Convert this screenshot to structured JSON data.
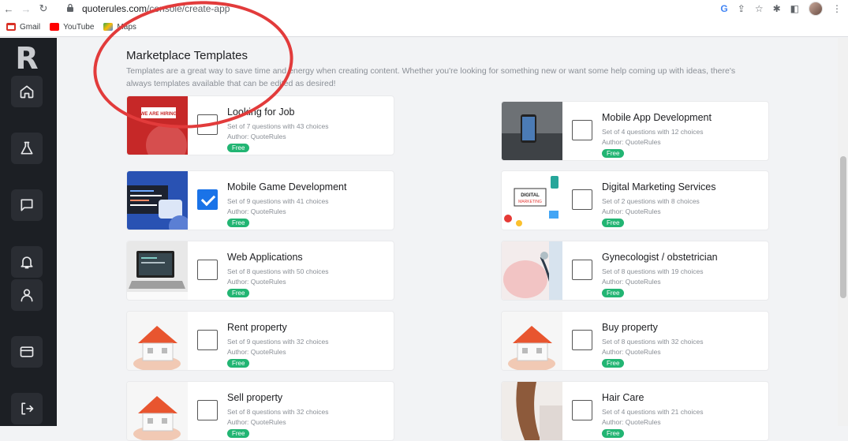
{
  "browser": {
    "url_host": "quoterules.com",
    "url_path": "/console/create-app",
    "bookmarks": [
      {
        "label": "Gmail",
        "color": "#d93025"
      },
      {
        "label": "YouTube",
        "color": "#ff0000"
      },
      {
        "label": "Maps",
        "color": "#34a853"
      }
    ]
  },
  "sidebar": {
    "logo": "R",
    "items": [
      "home-icon",
      "flask-icon",
      "chat-icon",
      "bell-icon",
      "user-icon",
      "card-icon",
      "logout-icon"
    ]
  },
  "main": {
    "title": "Marketplace Templates",
    "description": "Templates are a great way to save time and energy when creating content. Whether you're looking for something new or want some help coming up with ideas, there's always templates available that can be edited as desired!"
  },
  "templates": [
    {
      "title": "Looking for Job",
      "meta": "Set of 7 questions with 43 choices",
      "author": "Author: QuoteRules",
      "badge": "Free",
      "checked": false,
      "thumb": "hiring"
    },
    {
      "title": "Mobile App Development",
      "meta": "Set of 4 questions with 12 choices",
      "author": "Author: QuoteRules",
      "badge": "Free",
      "checked": false,
      "thumb": "phone"
    },
    {
      "title": "Mobile Game Development",
      "meta": "Set of 9 questions with 41 choices",
      "author": "Author: QuoteRules",
      "badge": "Free",
      "checked": true,
      "thumb": "code"
    },
    {
      "title": "Digital Marketing Services",
      "meta": "Set of 2 questions with 8 choices",
      "author": "Author: QuoteRules",
      "badge": "Free",
      "checked": false,
      "thumb": "marketing"
    },
    {
      "title": "Web Applications",
      "meta": "Set of 8 questions with 50 choices",
      "author": "Author: QuoteRules",
      "badge": "Free",
      "checked": false,
      "thumb": "laptop"
    },
    {
      "title": "Gynecologist / obstetrician",
      "meta": "Set of 8 questions with 19 choices",
      "author": "Author: QuoteRules",
      "badge": "Free",
      "checked": false,
      "thumb": "pregnant"
    },
    {
      "title": "Rent property",
      "meta": "Set of 9 questions with 32 choices",
      "author": "Author: QuoteRules",
      "badge": "Free",
      "checked": false,
      "thumb": "house"
    },
    {
      "title": "Buy property",
      "meta": "Set of 8 questions with 32 choices",
      "author": "Author: QuoteRules",
      "badge": "Free",
      "checked": false,
      "thumb": "house"
    },
    {
      "title": "Sell property",
      "meta": "Set of 8 questions with 32 choices",
      "author": "Author: QuoteRules",
      "badge": "Free",
      "checked": false,
      "thumb": "house"
    },
    {
      "title": "Hair Care",
      "meta": "Set of 4 questions with 21 choices",
      "author": "Author: QuoteRules",
      "badge": "Free",
      "checked": false,
      "thumb": "hair"
    }
  ],
  "thumb_text": {
    "hiring": "WE ARE HIRING",
    "marketing": "DIGITAL MARKETING"
  }
}
